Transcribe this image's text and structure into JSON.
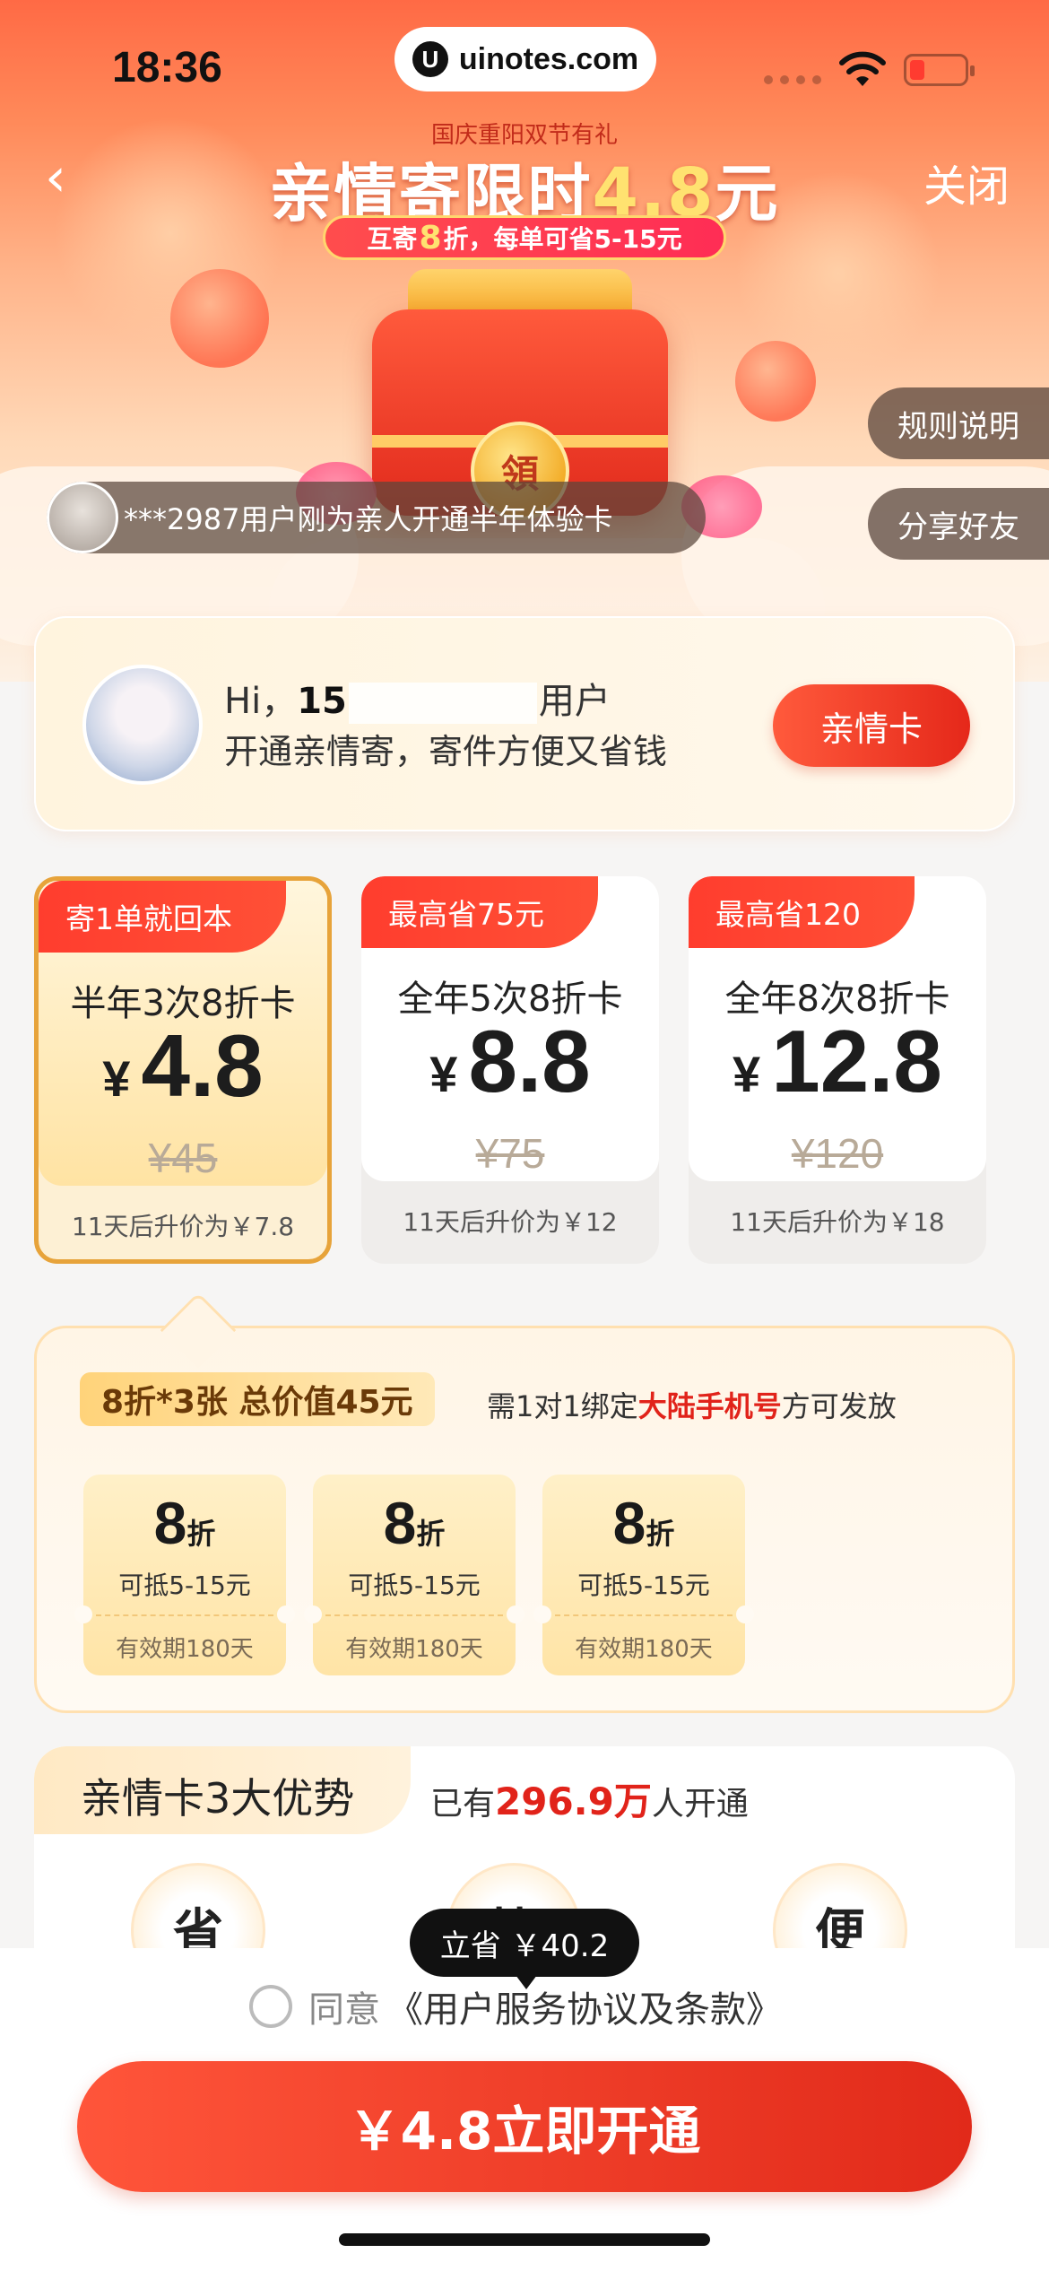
{
  "status_bar": {
    "time": "18:36",
    "url": "uinotes.com",
    "logo_glyph": "U"
  },
  "header": {
    "back_glyph": "‹",
    "close_label": "关闭",
    "subtitle": "国庆重阳双节有礼",
    "title_prefix": "亲情寄限时",
    "title_price": "4.8",
    "title_suffix": "元",
    "promo_prefix": "互寄",
    "promo_big": "8",
    "promo_suffix": "折，每单可省5-15元"
  },
  "hero": {
    "coin_label": "領"
  },
  "side_buttons": {
    "rules": "规则说明",
    "share": "分享好友"
  },
  "ticker": {
    "text": "***2987用户刚为亲人开通半年体验卡"
  },
  "user_card": {
    "greeting": "Hi，",
    "phone_prefix": "15",
    "suffix": "用户",
    "desc": "开通亲情寄，寄件方便又省钱",
    "button": "亲情卡"
  },
  "plans": [
    {
      "tag": "寄1单就回本",
      "name": "半年3次8折卡",
      "symbol": "¥",
      "price": "4.8",
      "original": "¥45",
      "upgrade": "11天后升价为￥7.8",
      "selected": true
    },
    {
      "tag": "最高省75元",
      "name": "全年5次8折卡",
      "symbol": "¥",
      "price": "8.8",
      "original": "¥75",
      "upgrade": "11天后升价为￥12",
      "selected": false
    },
    {
      "tag": "最高省120",
      "name": "全年8次8折卡",
      "symbol": "¥",
      "price": "12.8",
      "original": "¥120",
      "upgrade": "11天后升价为￥18",
      "selected": false
    }
  ],
  "coupons_section": {
    "title": "8折*3张 总价值45元",
    "note_prefix": "需1对1绑定",
    "note_red": "大陆手机号",
    "note_suffix": "方可发放",
    "coupons": [
      {
        "value": "8",
        "unit": "折",
        "deduct": "可抵5-15元",
        "validity": "有效期180天"
      },
      {
        "value": "8",
        "unit": "折",
        "deduct": "可抵5-15元",
        "validity": "有效期180天"
      },
      {
        "value": "8",
        "unit": "折",
        "deduct": "可抵5-15元",
        "validity": "有效期180天"
      }
    ]
  },
  "advantages": {
    "title": "亲情卡3大优势",
    "count_prefix": "已有",
    "count_value": "296.9万",
    "count_suffix": "人开通",
    "items": [
      "省",
      "快",
      "便"
    ]
  },
  "bottom": {
    "tooltip": "立省 ￥40.2",
    "agree_prefix": "同意",
    "agree_link": "《用户服务协议及条款》",
    "cta": "￥4.8立即开通"
  },
  "colors": {
    "brand_red": "#e5281a",
    "gold": "#e7a33a",
    "hero_top": "#ff6a45"
  }
}
